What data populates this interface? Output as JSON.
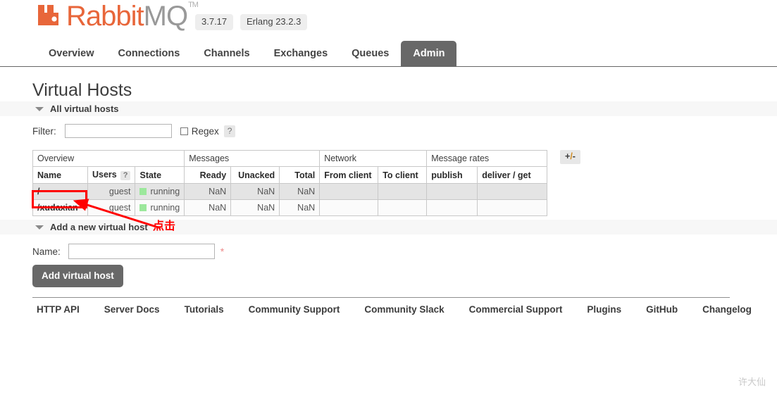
{
  "header": {
    "brand_rabbit": "Rabbit",
    "brand_mq": "MQ",
    "brand_tm": "TM",
    "version_badge": "3.7.17",
    "erlang_badge": "Erlang 23.2.3",
    "logo_color": "#e8663a"
  },
  "nav": {
    "items": [
      {
        "label": "Overview",
        "active": false
      },
      {
        "label": "Connections",
        "active": false
      },
      {
        "label": "Channels",
        "active": false
      },
      {
        "label": "Exchanges",
        "active": false
      },
      {
        "label": "Queues",
        "active": false
      },
      {
        "label": "Admin",
        "active": true
      }
    ],
    "active_color": "#686868"
  },
  "page": {
    "title": "Virtual Hosts"
  },
  "sections": {
    "all_vhosts_label": "All virtual hosts",
    "add_vhost_label": "Add a new virtual host"
  },
  "filter": {
    "label": "Filter:",
    "value": "",
    "placeholder": "",
    "regex_label": "Regex",
    "regex_checked": false,
    "help": "?"
  },
  "table": {
    "groups": [
      {
        "label": "Overview",
        "span": 3
      },
      {
        "label": "Messages",
        "span": 3
      },
      {
        "label": "Network",
        "span": 2
      },
      {
        "label": "Message rates",
        "span": 2
      }
    ],
    "columns": [
      "Name",
      "Users",
      "State",
      "Ready",
      "Unacked",
      "Total",
      "From client",
      "To client",
      "publish",
      "deliver / get"
    ],
    "users_help": "?",
    "toggle_columns": {
      "plus": "+",
      "slash": "/",
      "minus": "-"
    },
    "rows": [
      {
        "name": "/",
        "users": "guest",
        "state": "running",
        "ready": "NaN",
        "unacked": "NaN",
        "total": "NaN",
        "from_client": "",
        "to_client": "",
        "publish": "",
        "deliver_get": ""
      },
      {
        "name": "/xudaxian",
        "users": "guest",
        "state": "running",
        "ready": "NaN",
        "unacked": "NaN",
        "total": "NaN",
        "from_client": "",
        "to_client": "",
        "publish": "",
        "deliver_get": ""
      }
    ],
    "state_color": "#9ce89c"
  },
  "add_form": {
    "name_label": "Name:",
    "name_value": "",
    "name_placeholder": "",
    "required_mark": "*",
    "submit_label": "Add virtual host"
  },
  "footer": {
    "links": [
      "HTTP API",
      "Server Docs",
      "Tutorials",
      "Community Support",
      "Community Slack",
      "Commercial Support",
      "Plugins",
      "GitHub",
      "Changelog"
    ]
  },
  "annotations": {
    "click_text": "点击",
    "color": "#ff0000",
    "watermark": "许大仙"
  }
}
